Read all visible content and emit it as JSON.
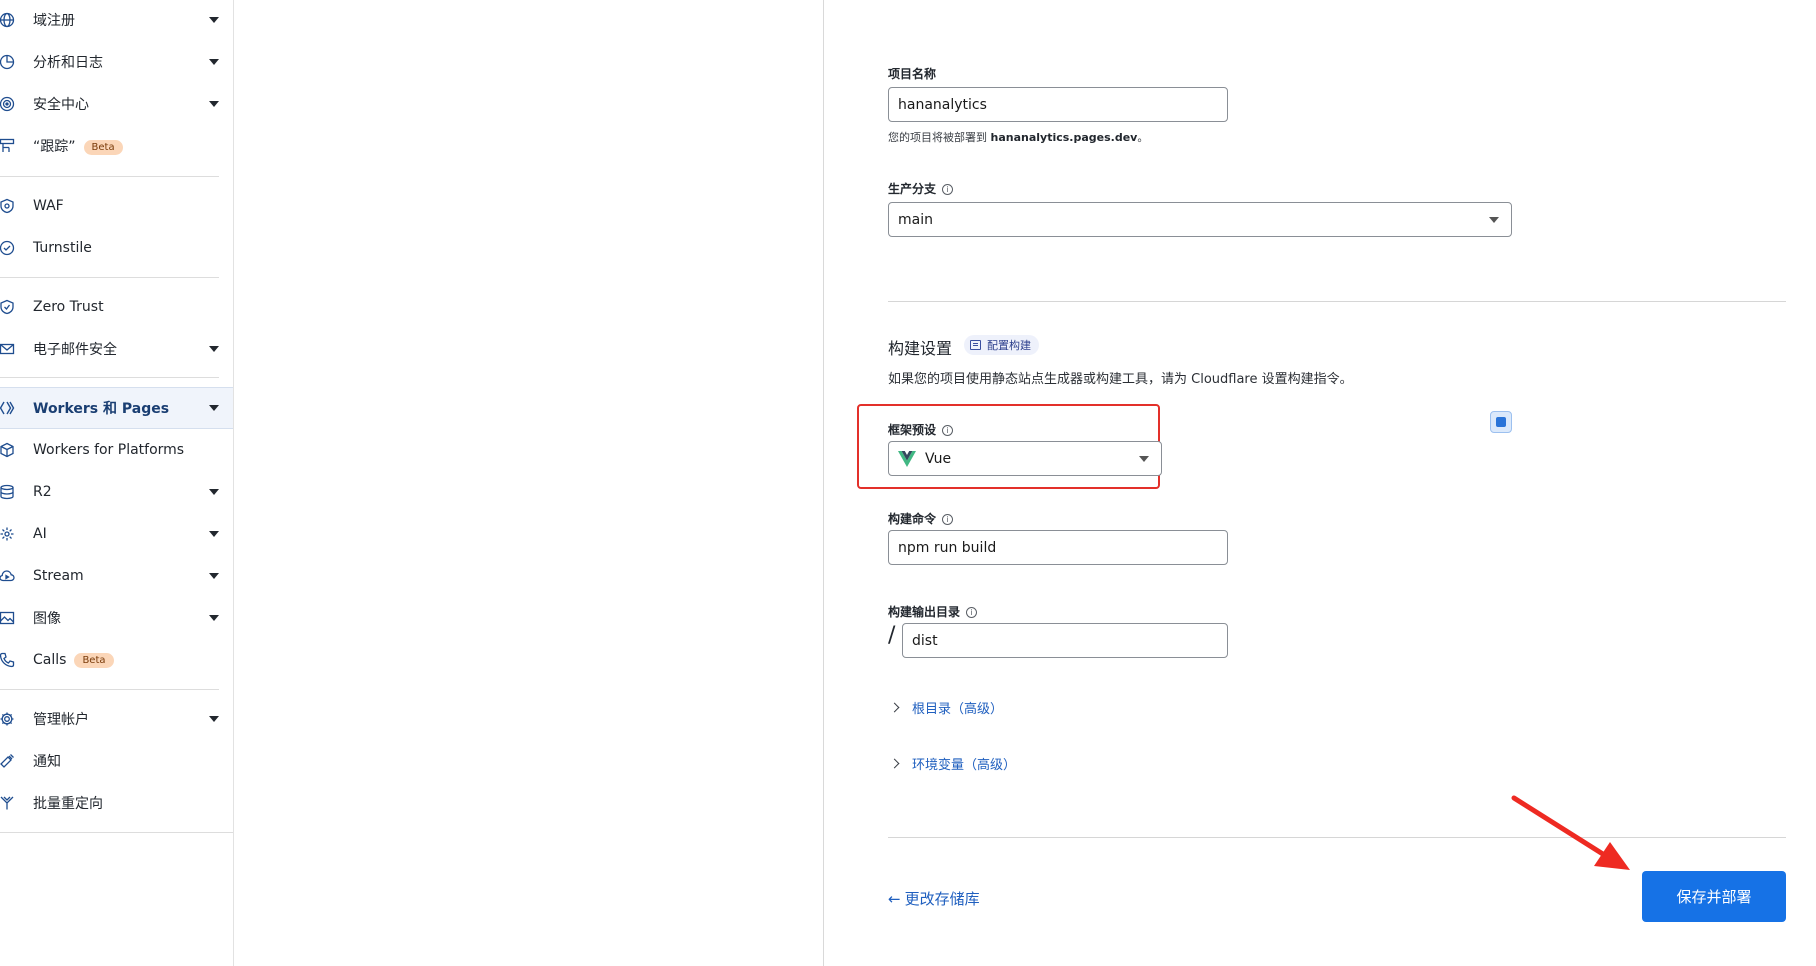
{
  "sidebar": {
    "items": [
      {
        "label": "域注册",
        "icon": "globe-icon",
        "caret": true
      },
      {
        "label": "分析和日志",
        "icon": "pie-chart-icon",
        "caret": true
      },
      {
        "label": "安全中心",
        "icon": "security-center-icon",
        "caret": true
      },
      {
        "label": "“跟踪”",
        "icon": "trace-icon",
        "badge": "Beta",
        "caret": false
      },
      {
        "label": "WAF",
        "icon": "waf-shield-icon",
        "caret": false
      },
      {
        "label": "Turnstile",
        "icon": "turnstile-icon",
        "caret": false
      },
      {
        "label": "Zero Trust",
        "icon": "zero-trust-icon",
        "caret": false
      },
      {
        "label": "电子邮件安全",
        "icon": "envelope-icon",
        "caret": true
      },
      {
        "label": "Workers 和 Pages",
        "icon": "workers-icon",
        "caret": true,
        "active": true
      },
      {
        "label": "Workers for Platforms",
        "icon": "cube-icon",
        "caret": false
      },
      {
        "label": "R2",
        "icon": "database-icon",
        "caret": true
      },
      {
        "label": "AI",
        "icon": "ai-icon",
        "caret": true
      },
      {
        "label": "Stream",
        "icon": "stream-cloud-icon",
        "caret": true
      },
      {
        "label": "图像",
        "icon": "image-icon",
        "caret": true
      },
      {
        "label": "Calls",
        "icon": "phone-icon",
        "badge": "Beta",
        "caret": false
      },
      {
        "label": "管理帐户",
        "icon": "gear-icon",
        "caret": true
      },
      {
        "label": "通知",
        "icon": "notification-icon",
        "caret": false
      },
      {
        "label": "批量重定向",
        "icon": "bulk-redirect-icon",
        "caret": false
      }
    ]
  },
  "form": {
    "project_name_label": "项目名称",
    "project_name_value": "hananalytics",
    "deploy_hint_prefix": "您的项目将被部署到 ",
    "deploy_hint_domain": "hananalytics.pages.dev",
    "deploy_hint_suffix": "。",
    "branch_label": "生产分支",
    "branch_value": "main",
    "build_section_title": "构建设置",
    "build_config_chip": "配置构建",
    "build_description": "如果您的项目使用静态站点生成器或构建工具，请为 Cloudflare 设置构建指令。",
    "framework_label": "框架预设",
    "framework_value": "Vue",
    "build_command_label": "构建命令",
    "build_command_value": "npm run build",
    "output_dir_label": "构建输出目录",
    "output_dir_prefix": "/",
    "output_dir_value": "dist",
    "root_dir_link": "根目录（高级）",
    "env_vars_link": "环境变量（高级）",
    "back_link": "更改存储库",
    "submit_button": "保存并部署",
    "info_glyph": "i"
  },
  "colors": {
    "primary": "#1672e6",
    "highlight": "#e3302a",
    "link": "#1f5fbf",
    "beta_badge": "#fbd6b8"
  }
}
